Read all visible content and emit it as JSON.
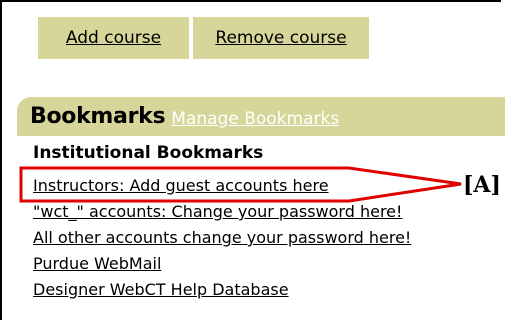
{
  "course_buttons": {
    "add_label": "Add course",
    "remove_label": "Remove course"
  },
  "bookmarks": {
    "title": "Bookmarks",
    "manage_label": "Manage Bookmarks",
    "section_title": "Institutional Bookmarks",
    "items": [
      "Instructors: Add guest accounts here",
      "\"wct_\" accounts: Change your password here!",
      "All other accounts change your password here!",
      "Purdue WebMail",
      "Designer WebCT Help Database"
    ]
  },
  "annotation": {
    "label": "[A]",
    "color": "#e00000"
  },
  "colors": {
    "header_bg": "#d6d69a",
    "manage_link": "#ffffff"
  }
}
